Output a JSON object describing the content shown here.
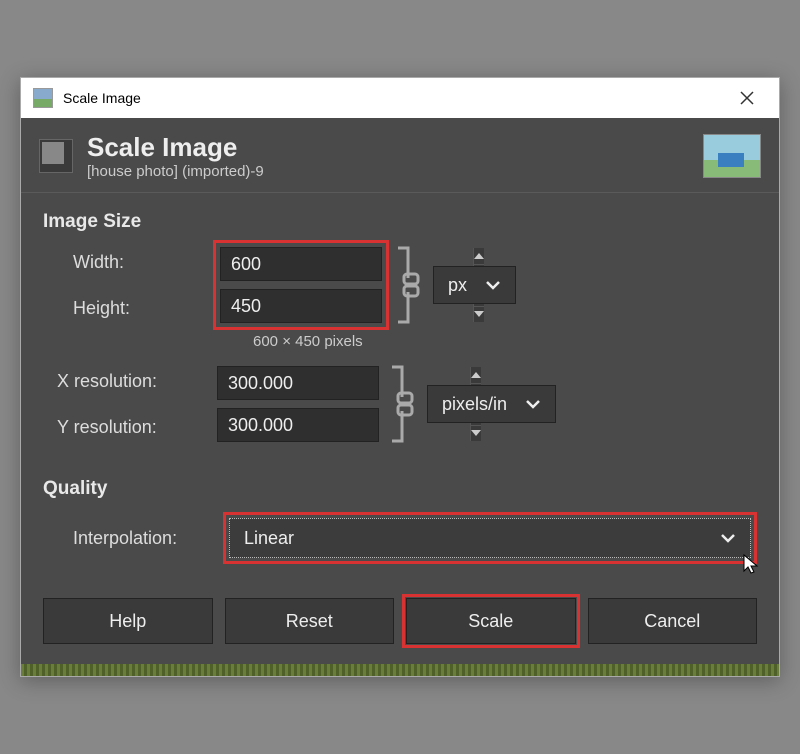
{
  "window": {
    "title": "Scale Image"
  },
  "header": {
    "title": "Scale Image",
    "subtitle": "[house photo] (imported)-9"
  },
  "sections": {
    "image_size": "Image Size",
    "quality": "Quality"
  },
  "labels": {
    "width": "Width:",
    "height": "Height:",
    "xres": "X resolution:",
    "yres": "Y resolution:",
    "interp": "Interpolation:"
  },
  "values": {
    "width": "600",
    "height": "450",
    "xres": "300.000",
    "yres": "300.000",
    "size_unit": "px",
    "res_unit": "pixels/in",
    "interp": "Linear"
  },
  "hint": "600 × 450 pixels",
  "buttons": {
    "help": "Help",
    "reset": "Reset",
    "scale": "Scale",
    "cancel": "Cancel"
  }
}
